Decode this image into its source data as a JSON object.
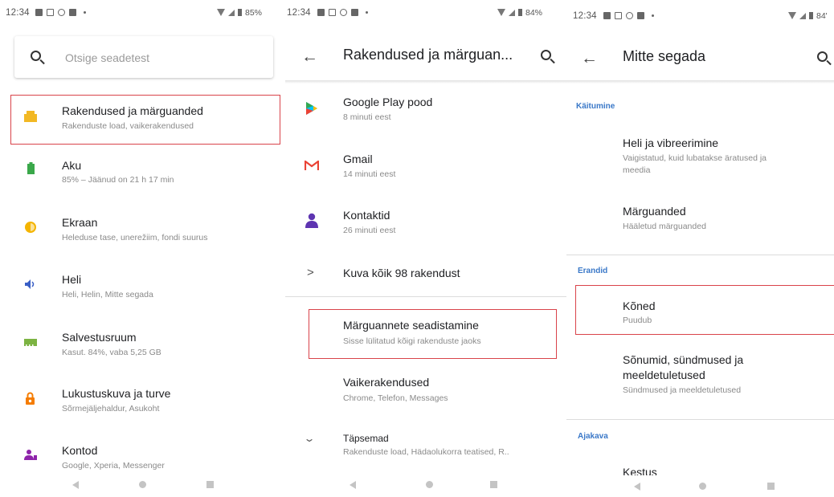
{
  "status": {
    "time": "12:34",
    "battery_p1": "85%",
    "battery_p2": "84%",
    "battery_p3": "84'"
  },
  "panel1": {
    "search_placeholder": "Otsige seadetest",
    "items": [
      {
        "title": "Rakendused ja märguanded",
        "subtitle": "Rakenduste load, vaikerakendused",
        "icon": "apps-icon",
        "color": "#f2b824"
      },
      {
        "title": "Aku",
        "subtitle": "85% – Jäänud on 21 h  17 min",
        "icon": "battery-icon",
        "color": "#3aa84a"
      },
      {
        "title": "Ekraan",
        "subtitle": "Heleduse tase, unerežiim, fondi suurus",
        "icon": "display-icon",
        "color": "#f4b400"
      },
      {
        "title": "Heli",
        "subtitle": "Heli, Helin, Mitte segada",
        "icon": "sound-icon",
        "color": "#3a5fc6"
      },
      {
        "title": "Salvestusruum",
        "subtitle": "Kasut. 84%, vaba 5,25 GB",
        "icon": "storage-icon",
        "color": "#7cb342"
      },
      {
        "title": "Lukustuskuva ja turve",
        "subtitle": "Sõrmejäljehaldur, Asukoht",
        "icon": "lock-icon",
        "color": "#f57c00"
      },
      {
        "title": "Kontod",
        "subtitle": "Google, Xperia, Messenger",
        "icon": "accounts-icon",
        "color": "#8e24aa"
      }
    ]
  },
  "panel2": {
    "title": "Rakendused ja märguan...",
    "apps": [
      {
        "title": "Google Play pood",
        "subtitle": "8 minuti eest",
        "icon": "play-store-icon"
      },
      {
        "title": "Gmail",
        "subtitle": "14 minuti eest",
        "icon": "gmail-icon"
      },
      {
        "title": "Kontaktid",
        "subtitle": "26 minuti eest",
        "icon": "contacts-icon"
      }
    ],
    "see_all": "Kuva kõik 98 rakendust",
    "settings": [
      {
        "title": "Märguannete seadistamine",
        "subtitle": "Sisse lülitatud kõigi rakenduste jaoks"
      },
      {
        "title": "Vaikerakendused",
        "subtitle": "Chrome, Telefon, Messages"
      },
      {
        "title": "Täpsemad",
        "subtitle": "Rakenduste load, Hädaolukorra teatised, R.."
      }
    ]
  },
  "panel3": {
    "title": "Mitte segada",
    "sections": {
      "behavior": "Käitumine",
      "exceptions": "Erandid",
      "schedule": "Ajakava"
    },
    "items": [
      {
        "title": "Heli ja vibreerimine",
        "subtitle1": "Vaigistatud, kuid lubatakse äratused ja",
        "subtitle2": "meedia"
      },
      {
        "title": "Märguanded",
        "subtitle1": "Hääletud märguanded"
      },
      {
        "title": "Kõned",
        "subtitle1": "Puudub"
      },
      {
        "title": "Sõnumid, sündmused ja",
        "title2": "meeldetuletused",
        "subtitle1": "Sündmused ja meeldetuletused"
      },
      {
        "title": "Kestus"
      }
    ]
  },
  "colors": {
    "highlight": "#d9434a",
    "section": "#3a78c8"
  }
}
